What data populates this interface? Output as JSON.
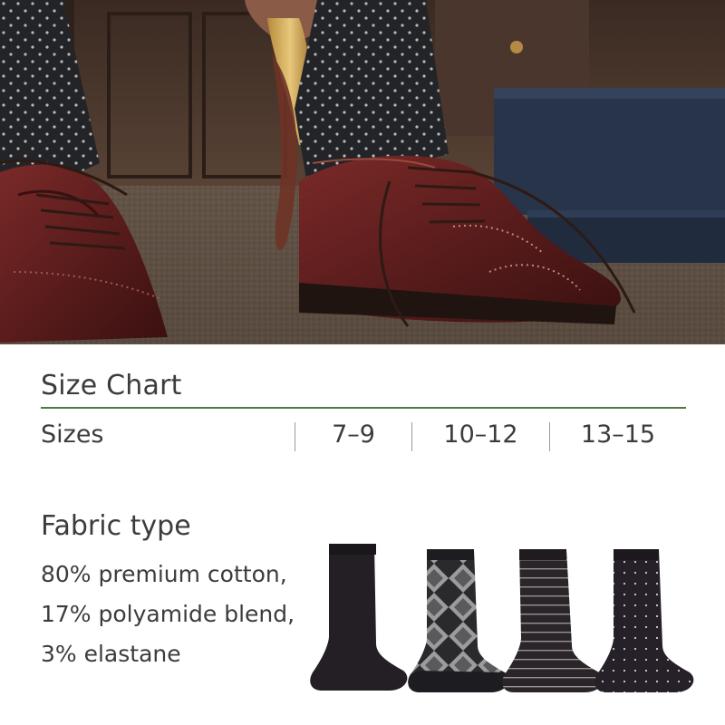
{
  "hero": {
    "icon": "dress-shoe-photo",
    "colors": {
      "shoe": "#5a1e1e",
      "sock": "#232428",
      "carpet": "#5e5044",
      "box": "#28344a"
    }
  },
  "size_chart": {
    "title": "Size Chart",
    "row_label": "Sizes",
    "sizes": [
      "7–9",
      "10–12",
      "13–15"
    ],
    "accent_color": "#4e7a3a"
  },
  "fabric": {
    "title": "Fabric type",
    "lines": [
      "80% premium cotton,",
      "17% polyamide blend,",
      "3% elastane"
    ]
  },
  "socks": [
    {
      "pattern": "solid"
    },
    {
      "pattern": "argyle"
    },
    {
      "pattern": "stripes"
    },
    {
      "pattern": "dots"
    }
  ]
}
